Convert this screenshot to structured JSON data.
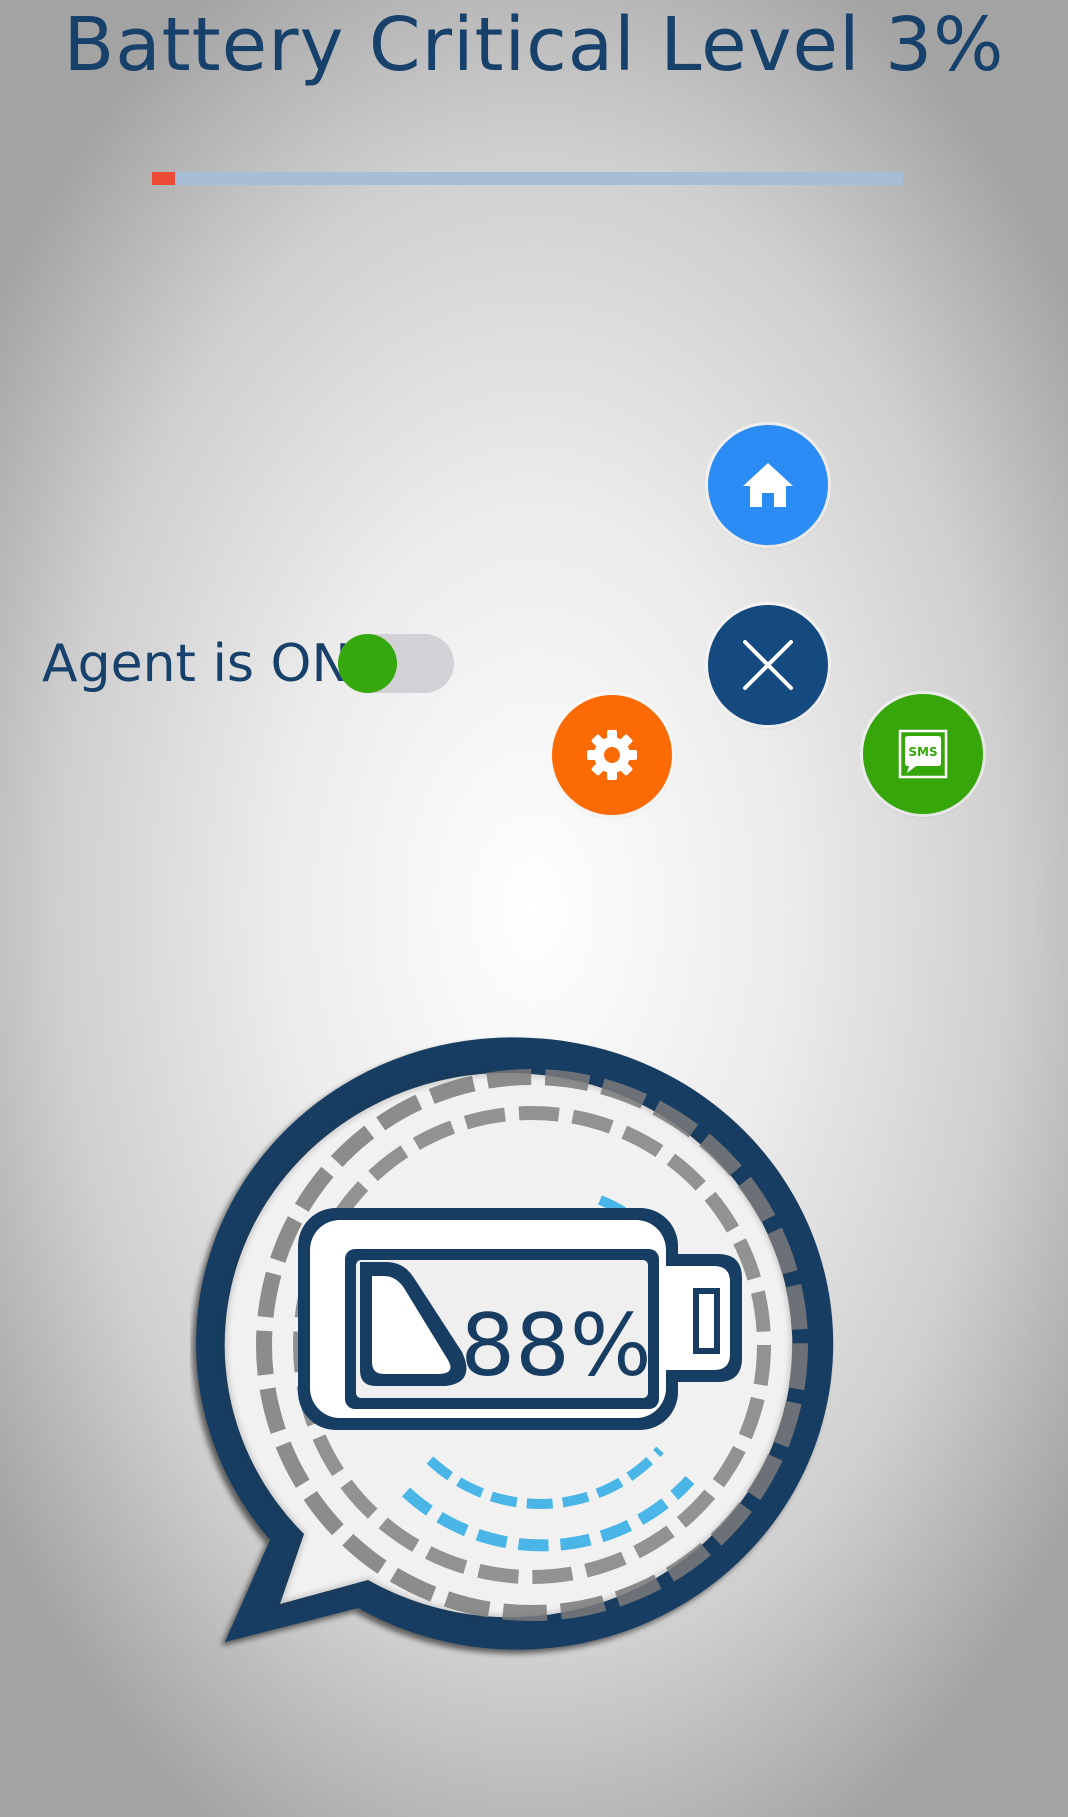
{
  "header": {
    "title": "Battery Critical Level 3%"
  },
  "battery_level": {
    "percent": 3,
    "fill_color": "#ec4b35",
    "track_color": "#a8bdd6"
  },
  "agent": {
    "label": "Agent is ON",
    "toggle_on": true,
    "toggle_color": "#35a80e"
  },
  "fab_menu": {
    "items": [
      {
        "name": "home",
        "icon": "home-icon",
        "color": "#2b8cf6"
      },
      {
        "name": "close",
        "icon": "close-icon",
        "color": "#154a80"
      },
      {
        "name": "settings",
        "icon": "gear-icon",
        "color": "#fc6a06"
      },
      {
        "name": "sms",
        "icon": "sms-icon",
        "color": "#36a60b",
        "label": "SMS"
      }
    ]
  },
  "logo": {
    "battery_percent_text": "88%",
    "primary_color": "#173d62",
    "accent_color": "#4ab6e8"
  }
}
